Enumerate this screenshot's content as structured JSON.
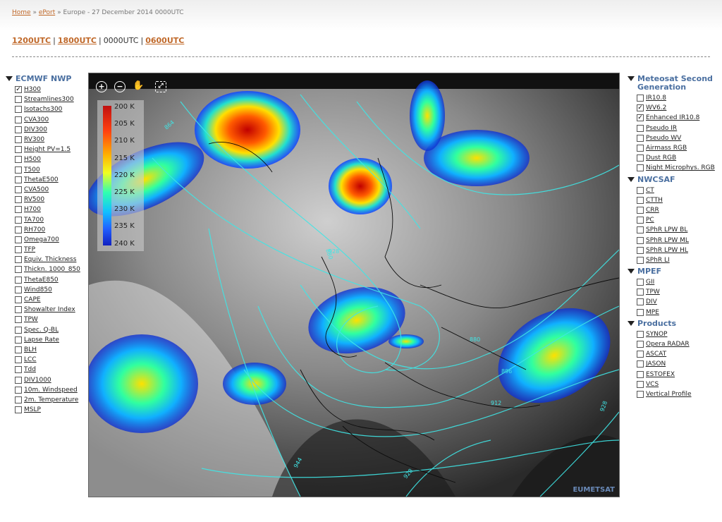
{
  "breadcrumb": {
    "home": "Home",
    "eport": "ePort",
    "current": "Europe - 27 December 2014 0000UTC",
    "sep": "»"
  },
  "times": [
    {
      "label": "1200UTC",
      "active": false
    },
    {
      "label": "1800UTC",
      "active": false
    },
    {
      "label": "0000UTC",
      "active": true
    },
    {
      "label": "0600UTC",
      "active": false
    }
  ],
  "left": {
    "title": "ECMWF NWP",
    "items": [
      {
        "label": "H300",
        "checked": true
      },
      {
        "label": "Streamlines300",
        "checked": false
      },
      {
        "label": "Isotachs300",
        "checked": false
      },
      {
        "label": "CVA300",
        "checked": false
      },
      {
        "label": "DIV300",
        "checked": false
      },
      {
        "label": "RV300",
        "checked": false
      },
      {
        "label": "Height PV=1.5",
        "checked": false
      },
      {
        "label": "H500",
        "checked": false
      },
      {
        "label": "T500",
        "checked": false
      },
      {
        "label": "ThetaE500",
        "checked": false
      },
      {
        "label": "CVA500",
        "checked": false
      },
      {
        "label": "RV500",
        "checked": false
      },
      {
        "label": "H700",
        "checked": false
      },
      {
        "label": "TA700",
        "checked": false
      },
      {
        "label": "RH700",
        "checked": false
      },
      {
        "label": "Omega700",
        "checked": false
      },
      {
        "label": "TFP",
        "checked": false
      },
      {
        "label": "Equiv. Thickness",
        "checked": false
      },
      {
        "label": "Thickn. 1000_850",
        "checked": false
      },
      {
        "label": "ThetaE850",
        "checked": false
      },
      {
        "label": "Wind850",
        "checked": false
      },
      {
        "label": "CAPE",
        "checked": false
      },
      {
        "label": "Showalter Index",
        "checked": false
      },
      {
        "label": "TPW",
        "checked": false
      },
      {
        "label": "Spec. Q-BL",
        "checked": false
      },
      {
        "label": "Lapse Rate",
        "checked": false
      },
      {
        "label": "BLH",
        "checked": false
      },
      {
        "label": "LCC",
        "checked": false
      },
      {
        "label": "Tdd",
        "checked": false
      },
      {
        "label": "DIV1000",
        "checked": false
      },
      {
        "label": "10m. Windspeed",
        "checked": false
      },
      {
        "label": "2m. Temperature",
        "checked": false
      },
      {
        "label": "MSLP",
        "checked": false
      }
    ]
  },
  "right": [
    {
      "title": "Meteosat Second Generation",
      "items": [
        {
          "label": "IR10.8",
          "checked": false
        },
        {
          "label": "WV6.2",
          "checked": true
        },
        {
          "label": "Enhanced IR10.8",
          "checked": true
        },
        {
          "label": "Pseudo IR",
          "checked": false
        },
        {
          "label": "Pseudo WV",
          "checked": false
        },
        {
          "label": "Airmass RGB",
          "checked": false
        },
        {
          "label": "Dust RGB",
          "checked": false
        },
        {
          "label": "Night Microphys. RGB",
          "checked": false
        }
      ]
    },
    {
      "title": "NWCSAF",
      "items": [
        {
          "label": "CT",
          "checked": false
        },
        {
          "label": "CTTH",
          "checked": false
        },
        {
          "label": "CRR",
          "checked": false
        },
        {
          "label": "PC",
          "checked": false
        },
        {
          "label": "SPhR LPW BL",
          "checked": false
        },
        {
          "label": "SPhR LPW ML",
          "checked": false
        },
        {
          "label": "SPhR LPW HL",
          "checked": false
        },
        {
          "label": "SPhR LI",
          "checked": false
        }
      ]
    },
    {
      "title": "MPEF",
      "items": [
        {
          "label": "GII",
          "checked": false
        },
        {
          "label": "TPW",
          "checked": false
        },
        {
          "label": "DIV",
          "checked": false
        },
        {
          "label": "MPE",
          "checked": false
        }
      ]
    },
    {
      "title": "Products",
      "items": [
        {
          "label": "SYNOP",
          "checked": false
        },
        {
          "label": "Opera RADAR",
          "checked": false
        },
        {
          "label": "ASCAT",
          "checked": false
        },
        {
          "label": "JASON",
          "checked": false
        },
        {
          "label": "ESTOFEX",
          "checked": false
        },
        {
          "label": "VCS",
          "checked": false
        },
        {
          "label": "Vertical Profile",
          "checked": false
        }
      ]
    }
  ],
  "map": {
    "controls": [
      "zoom-in-icon",
      "zoom-out-icon",
      "pan-hand-icon",
      "fullscreen-icon"
    ],
    "legend": [
      "200 K",
      "205 K",
      "210 K",
      "215 K",
      "220 K",
      "225 K",
      "230 K",
      "235 K",
      "240 K"
    ],
    "contours": [
      "928",
      "880",
      "896",
      "912",
      "944",
      "864"
    ],
    "brand": "EUMETSAT"
  }
}
